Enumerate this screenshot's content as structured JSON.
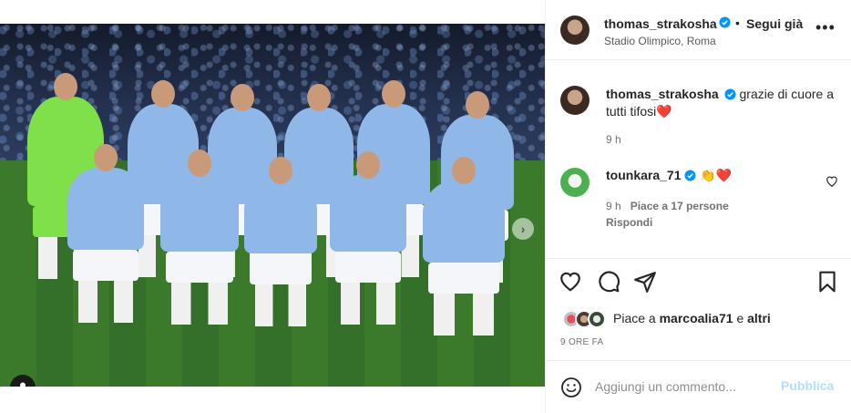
{
  "post": {
    "author": "thomas_strakosha",
    "follow_label": "Segui già",
    "separator": "•",
    "location": "Stadio Olimpico, Roma",
    "more_label": "•••",
    "photo": {
      "carousel_index": 1,
      "carousel_count": 2,
      "next_label": "›"
    }
  },
  "comments": [
    {
      "username": "thomas_strakosha",
      "text": "grazie di cuore a tutti tifosi",
      "emoji": "❤️",
      "time": "9 h"
    },
    {
      "username": "tounkara_71",
      "text": "👏❤️",
      "time": "9 h",
      "likes": "Piace a 17 persone",
      "reply_label": "Rispondi"
    }
  ],
  "likes": {
    "prefix": "Piace a",
    "user": "marcoalia71",
    "suffix": "e altri"
  },
  "post_time": "9 ORE FA",
  "composer": {
    "placeholder": "Aggiungi un commento...",
    "publish_label": "Pubblica"
  },
  "colors": {
    "verified": "#0095f6",
    "heart": "#ed4956",
    "publish_disabled": "#b2dffc",
    "border": "#efefef"
  }
}
